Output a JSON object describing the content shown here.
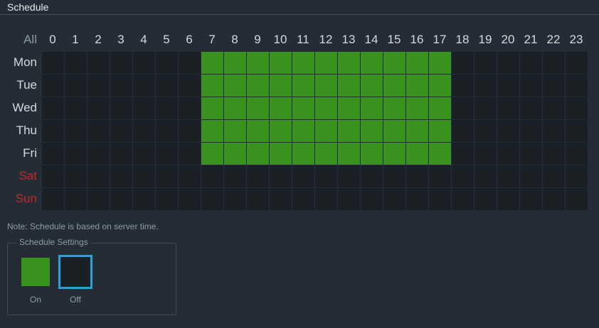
{
  "section": {
    "title": "Schedule"
  },
  "grid": {
    "all_label": "All",
    "hours": [
      "0",
      "1",
      "2",
      "3",
      "4",
      "5",
      "6",
      "7",
      "8",
      "9",
      "10",
      "11",
      "12",
      "13",
      "14",
      "15",
      "16",
      "17",
      "18",
      "19",
      "20",
      "21",
      "22",
      "23"
    ],
    "days": [
      {
        "label": "Mon",
        "weekend": false,
        "on_hours": [
          7,
          8,
          9,
          10,
          11,
          12,
          13,
          14,
          15,
          16,
          17
        ]
      },
      {
        "label": "Tue",
        "weekend": false,
        "on_hours": [
          7,
          8,
          9,
          10,
          11,
          12,
          13,
          14,
          15,
          16,
          17
        ]
      },
      {
        "label": "Wed",
        "weekend": false,
        "on_hours": [
          7,
          8,
          9,
          10,
          11,
          12,
          13,
          14,
          15,
          16,
          17
        ]
      },
      {
        "label": "Thu",
        "weekend": false,
        "on_hours": [
          7,
          8,
          9,
          10,
          11,
          12,
          13,
          14,
          15,
          16,
          17
        ]
      },
      {
        "label": "Fri",
        "weekend": false,
        "on_hours": [
          7,
          8,
          9,
          10,
          11,
          12,
          13,
          14,
          15,
          16,
          17
        ]
      },
      {
        "label": "Sat",
        "weekend": true,
        "on_hours": []
      },
      {
        "label": "Sun",
        "weekend": true,
        "on_hours": []
      }
    ]
  },
  "note": "Note: Schedule is based on server time.",
  "settings": {
    "legend": "Schedule Settings",
    "on_label": "On",
    "off_label": "Off",
    "selected": "Off"
  },
  "colors": {
    "on": "#3a921f",
    "off": "#1b2025",
    "weekend_text": "#c0282b",
    "weekday_text": "#d4d9de",
    "selection_border": "#2e9fd8"
  }
}
